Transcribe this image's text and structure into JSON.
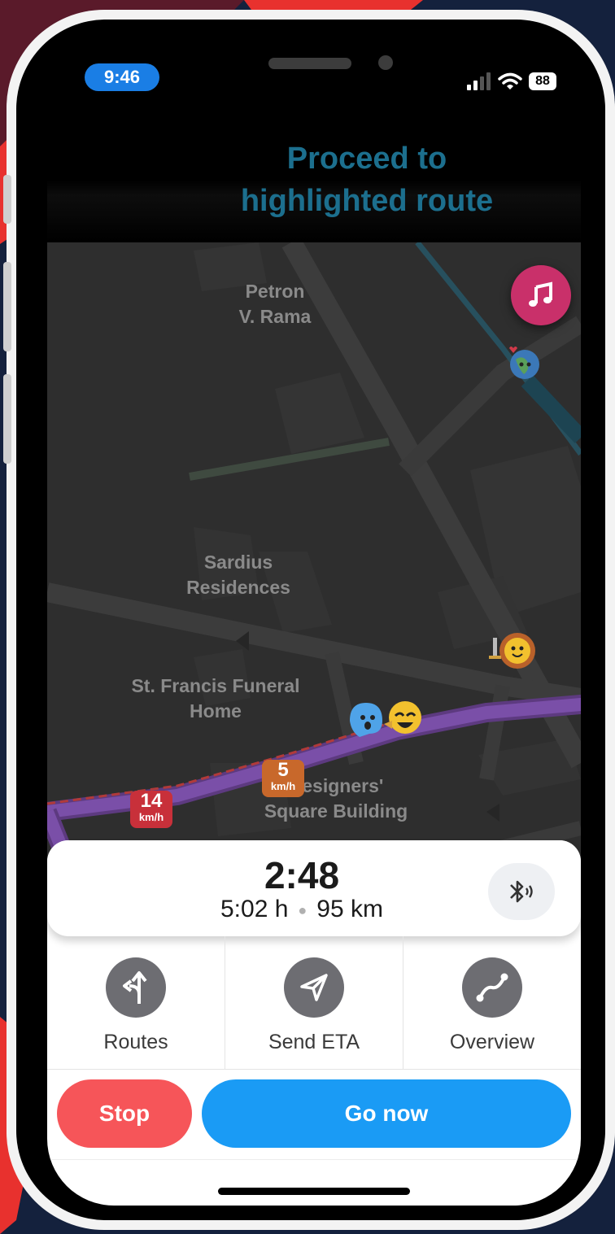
{
  "status_bar": {
    "time": "9:46",
    "battery": "88"
  },
  "instruction": {
    "line1": "Proceed to",
    "line2": "highlighted route"
  },
  "map": {
    "pois": [
      {
        "line1": "Petron",
        "line2": "V. Rama"
      },
      {
        "line1": "Sardius",
        "line2": "Residences"
      },
      {
        "line1": "St. Francis Funeral",
        "line2": "Home"
      },
      {
        "line1": "Designers'",
        "line2": "Square Building"
      }
    ],
    "speed_signs": [
      {
        "value": "5",
        "unit": "km/h",
        "color": "#c8682b"
      },
      {
        "value": "14",
        "unit": "km/h",
        "color": "#c8303a"
      }
    ],
    "route_color": "#7a4fa8"
  },
  "eta": {
    "arrival": "2:48",
    "duration": "5:02 h",
    "distance": "95 km"
  },
  "actions": [
    {
      "label": "Routes",
      "icon": "routes-icon"
    },
    {
      "label": "Send ETA",
      "icon": "send-icon"
    },
    {
      "label": "Overview",
      "icon": "overview-icon"
    }
  ],
  "buttons": {
    "stop": "Stop",
    "go": "Go now"
  },
  "colors": {
    "stop": "#f65559",
    "go": "#1a9bf5",
    "time_pill": "#1a7ee5",
    "instruction": "#1c6f8e"
  }
}
